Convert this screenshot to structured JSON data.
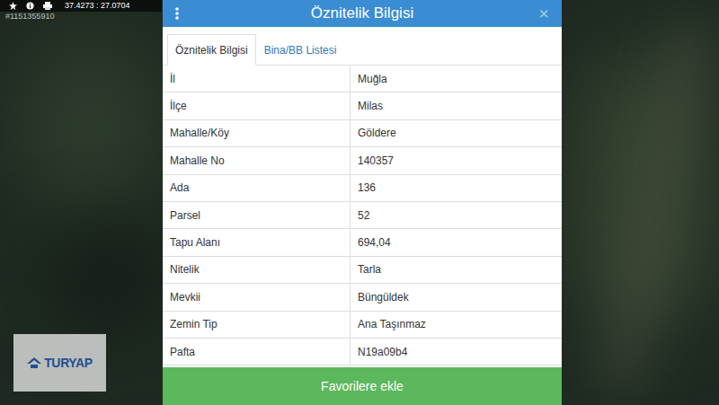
{
  "toolbar": {
    "coordinates": "37.4273 : 27.0704",
    "listing_id": "#1151355910"
  },
  "panel": {
    "title": "Öznitelik Bilgisi",
    "close": "×"
  },
  "tabs": [
    {
      "label": "Öznitelik Bilgisi",
      "selected": true
    },
    {
      "label": "Bina/BB Listesi",
      "selected": false
    }
  ],
  "rows": [
    [
      "İl",
      "Muğla"
    ],
    [
      "İlçe",
      "Milas"
    ],
    [
      "Mahalle/Köy",
      "Göldere"
    ],
    [
      "Mahalle No",
      "140357"
    ],
    [
      "Ada",
      "136"
    ],
    [
      "Parsel",
      "52"
    ],
    [
      "Tapu Alanı",
      "694,04"
    ],
    [
      "Nitelik",
      "Tarla"
    ],
    [
      "Mevkii",
      "Büngüldek"
    ],
    [
      "Zemin Tip",
      "Ana Taşınmaz"
    ],
    [
      "Pafta",
      "N19a09b4"
    ]
  ],
  "button": "Favorilere ekle",
  "logo": "TURYAP"
}
